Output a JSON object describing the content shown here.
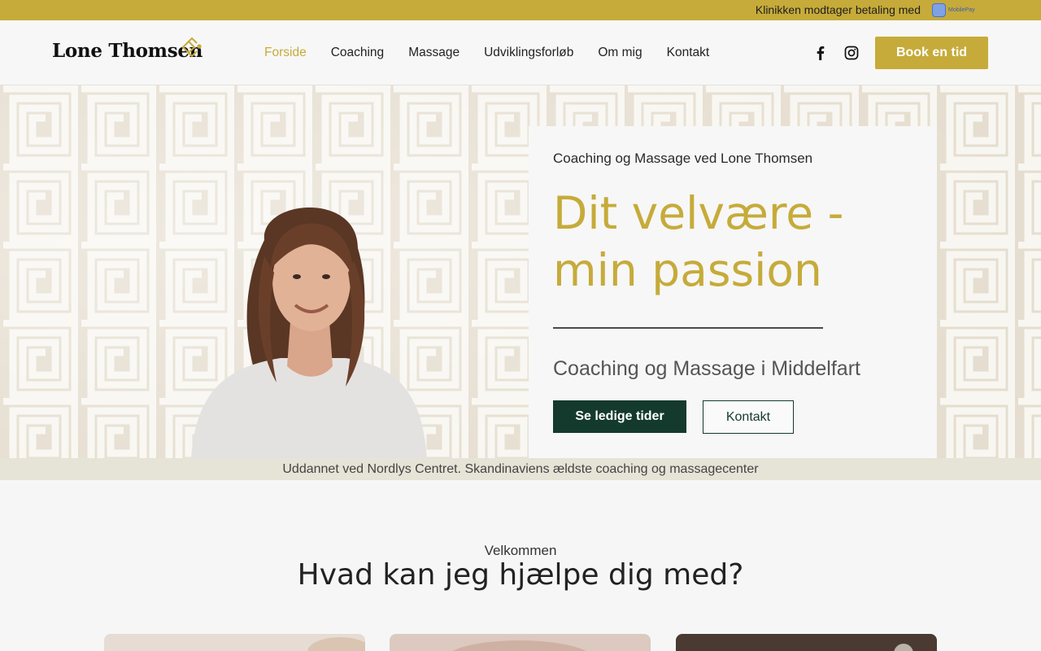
{
  "topbar": {
    "text": "Klinikken modtager betaling med",
    "payment_logo": "MobilePay"
  },
  "header": {
    "logo": "Lone Thomsen",
    "nav": [
      "Forside",
      "Coaching",
      "Massage",
      "Udviklingsforløb",
      "Om mig",
      "Kontakt"
    ],
    "active_nav": "Forside",
    "social_icons": [
      "facebook-icon",
      "instagram-icon"
    ],
    "book_button": "Book en tid"
  },
  "hero": {
    "kicker": "Coaching og Massage ved Lone Thomsen",
    "title": "Dit velvære - min passion",
    "subtitle": "Coaching og Massage i Middelfart",
    "primary_button": "Se ledige tider",
    "secondary_button": "Kontakt"
  },
  "strip": {
    "text": "Uddannet ved Nordlys Centret. Skandinaviens ældste coaching og massagecenter"
  },
  "intro": {
    "kicker": "Velkommen",
    "heading": "Hvad kan jeg hjælpe dig med?"
  },
  "colors": {
    "gold": "#c6ab3a",
    "dark_green": "#143a2e",
    "background": "#f6f6f6"
  }
}
